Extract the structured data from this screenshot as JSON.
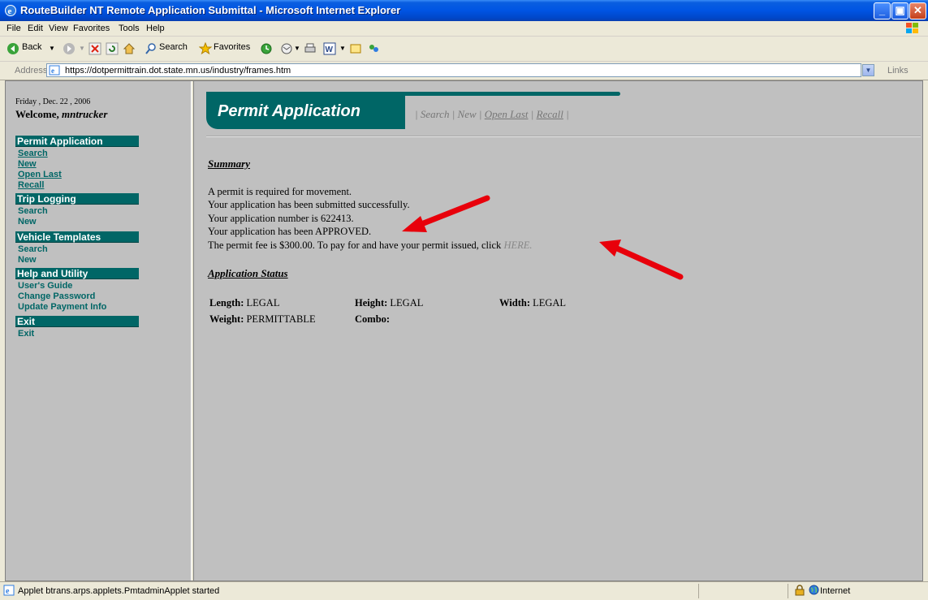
{
  "window": {
    "title": "RouteBuilder NT Remote Application Submittal - Microsoft Internet Explorer"
  },
  "menu": [
    "File",
    "Edit",
    "View",
    "Favorites",
    "Tools",
    "Help"
  ],
  "toolbar": {
    "back": "Back",
    "search": "Search",
    "favorites": "Favorites"
  },
  "address": {
    "label": "Address",
    "url": "https://dotpermittrain.dot.state.mn.us/industry/frames.htm",
    "links": "Links"
  },
  "sidebar": {
    "date": "Friday , Dec. 22 , 2006",
    "welcome_prefix": "Welcome,",
    "username": "mntrucker",
    "sections": [
      {
        "title": "Permit Application",
        "items": [
          "Search",
          "New",
          "Open Last",
          "Recall"
        ]
      },
      {
        "title": "Trip Logging",
        "items": [
          "Search",
          "New"
        ]
      },
      {
        "title": "Vehicle Templates",
        "items": [
          "Search",
          "New"
        ]
      },
      {
        "title": "Help and Utility",
        "items": [
          "User's Guide",
          "Change Password",
          "Update Payment Info"
        ]
      },
      {
        "title": "Exit",
        "items": [
          "Exit"
        ]
      }
    ]
  },
  "main": {
    "banner_title": "Permit Application",
    "nav": {
      "sep": "|",
      "search": "Search",
      "new": "New",
      "open_last": "Open Last",
      "recall": "Recall"
    },
    "summary_heading": "Summary",
    "messages": [
      "A permit is required for movement.",
      "Your application has been submitted successfully.",
      "Your application number is 622413.",
      "Your application has been APPROVED."
    ],
    "fee_text": "The permit fee is $300.00. To pay for and have your permit issued, click",
    "here_link": "HERE.",
    "status_heading": "Application Status",
    "status": {
      "length_label": "Length:",
      "length_value": "LEGAL",
      "height_label": "Height:",
      "height_value": "LEGAL",
      "width_label": "Width:",
      "width_value": "LEGAL",
      "weight_label": "Weight:",
      "weight_value": "PERMITTABLE",
      "combo_label": "Combo:",
      "combo_value": ""
    }
  },
  "statusbar": {
    "text": "Applet btrans.arps.applets.PmtadminApplet started",
    "zone": "Internet"
  },
  "colors": {
    "accent": "#006666",
    "annotation_arrow": "#e8000b"
  }
}
